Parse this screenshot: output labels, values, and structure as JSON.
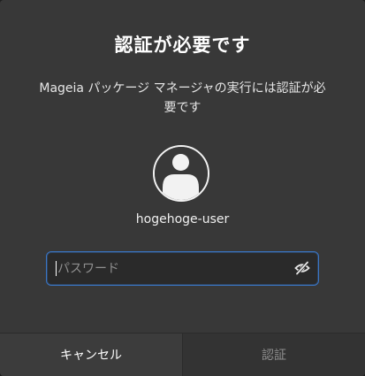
{
  "dialog": {
    "title": "認証が必要です",
    "message": "Mageia パッケージ マネージャの実行には認証が必要です",
    "username": "hogehoge-user",
    "avatar_icon": "user-avatar-icon"
  },
  "password": {
    "placeholder": "パスワード",
    "value": "",
    "toggle_icon": "eye-slash-icon"
  },
  "buttons": {
    "cancel_label": "キャンセル",
    "auth_label": "認証"
  },
  "colors": {
    "background": "#383838",
    "focus_border": "#3a75c4",
    "disabled_text": "#8e8e8e"
  }
}
